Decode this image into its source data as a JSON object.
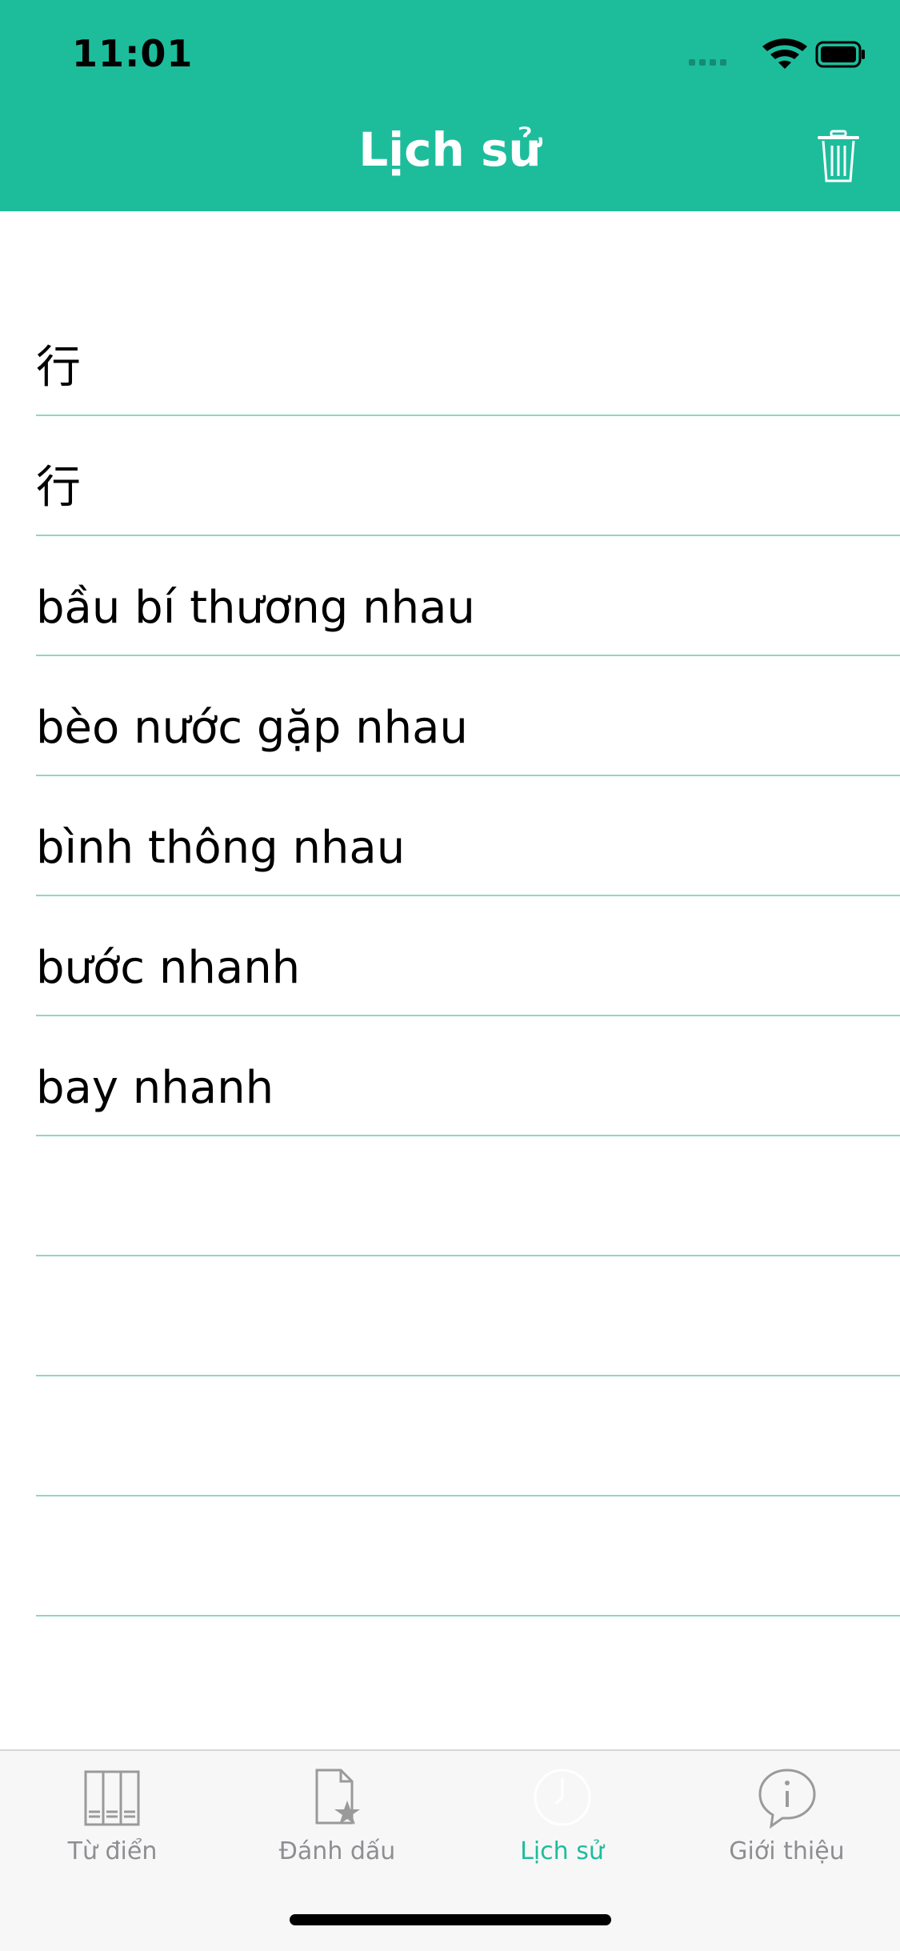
{
  "status_bar": {
    "time": "11:01"
  },
  "nav": {
    "title": "Lịch sử",
    "trash_icon": "trash-icon"
  },
  "history": {
    "items": [
      "行",
      "行",
      "bầu bí thương nhau",
      "bèo nước gặp nhau",
      "bình thông nhau",
      "bước nhanh",
      "bay nhanh",
      "",
      "",
      "",
      ""
    ]
  },
  "tab_bar": {
    "tabs": [
      {
        "label": "Từ điển",
        "icon": "book-icon",
        "active": false
      },
      {
        "label": "Đánh dấu",
        "icon": "bookmark-star-icon",
        "active": false
      },
      {
        "label": "Lịch sử",
        "icon": "clock-icon",
        "active": true
      },
      {
        "label": "Giới thiệu",
        "icon": "info-bubble-icon",
        "active": false
      }
    ]
  },
  "colors": {
    "accent": "#1dbd9c",
    "separator": "#8fd6c6",
    "tab_inactive": "#8e8e93"
  }
}
